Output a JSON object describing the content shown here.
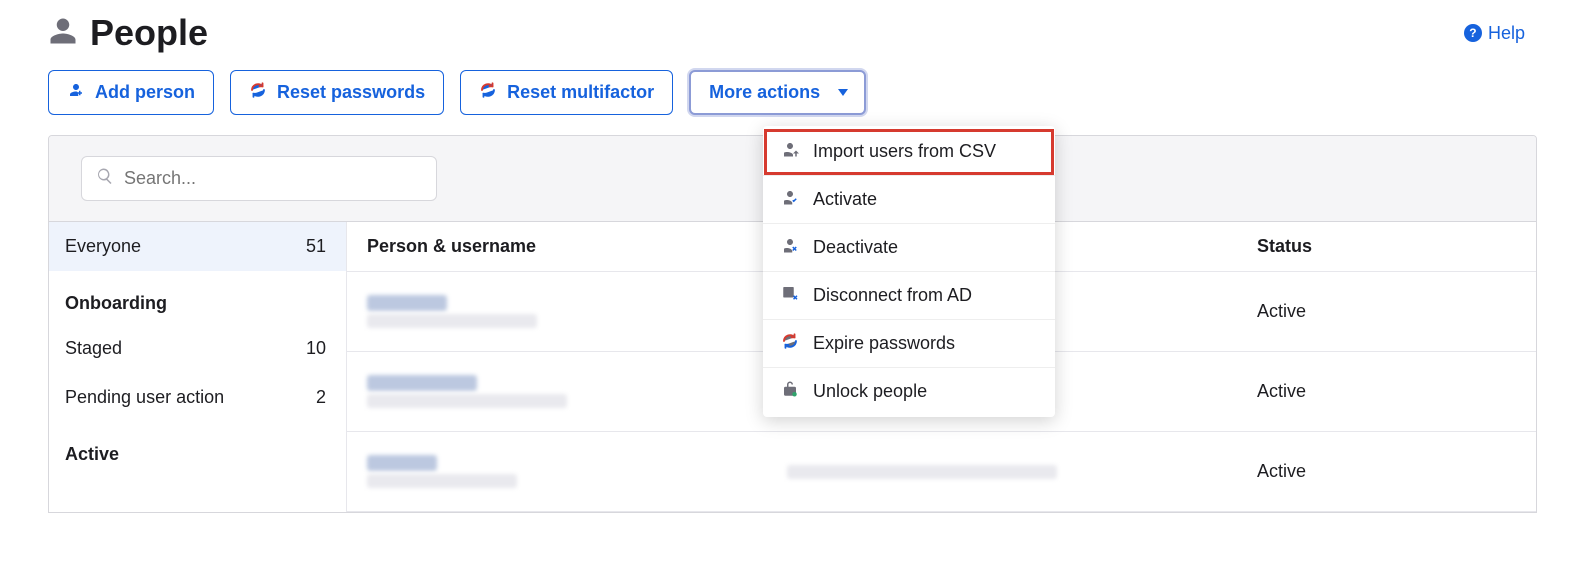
{
  "header": {
    "title": "People",
    "help_label": "Help"
  },
  "toolbar": {
    "add_person": "Add person",
    "reset_passwords": "Reset passwords",
    "reset_multifactor": "Reset multifactor",
    "more_actions": "More actions"
  },
  "dropdown": {
    "items": [
      {
        "label": "Import users from CSV",
        "icon": "person-arrow-icon",
        "highlighted": true
      },
      {
        "label": "Activate",
        "icon": "person-check-icon"
      },
      {
        "label": "Deactivate",
        "icon": "person-x-icon"
      },
      {
        "label": "Disconnect from AD",
        "icon": "ad-x-icon"
      },
      {
        "label": "Expire passwords",
        "icon": "sync-icon"
      },
      {
        "label": "Unlock people",
        "icon": "lock-open-icon"
      }
    ]
  },
  "search": {
    "placeholder": "Search..."
  },
  "sidebar": {
    "everyone": {
      "label": "Everyone",
      "count": "51"
    },
    "onboarding_header": "Onboarding",
    "staged": {
      "label": "Staged",
      "count": "10"
    },
    "pending": {
      "label": "Pending user action",
      "count": "2"
    },
    "active_header": "Active"
  },
  "table": {
    "col_person": "Person & username",
    "col_status": "Status",
    "rows": [
      {
        "status": "Active"
      },
      {
        "status": "Active"
      },
      {
        "status": "Active"
      }
    ]
  }
}
